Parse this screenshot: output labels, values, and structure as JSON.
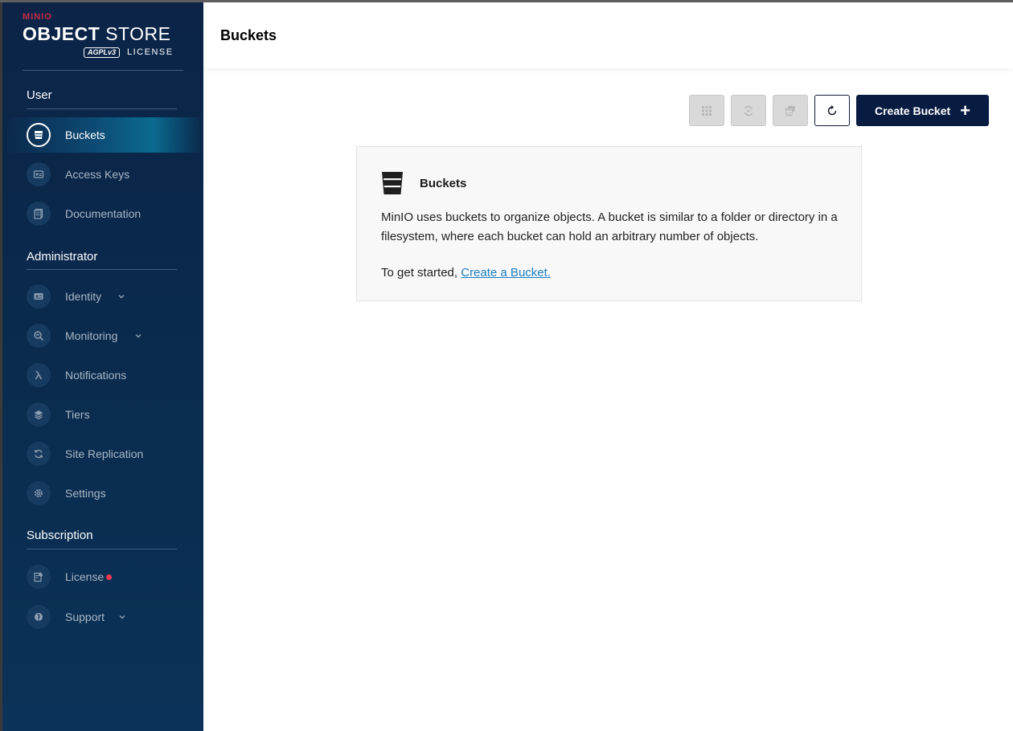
{
  "logo": {
    "brand": "MINIO",
    "product_bold": "OBJECT",
    "product_thin": "STORE",
    "badge": "AGPLv3",
    "license_word": "LICENSE"
  },
  "sidebar": {
    "sections": {
      "user": "User",
      "administrator": "Administrator",
      "subscription": "Subscription"
    },
    "items": {
      "buckets": "Buckets",
      "access_keys": "Access Keys",
      "documentation": "Documentation",
      "identity": "Identity",
      "monitoring": "Monitoring",
      "notifications": "Notifications",
      "tiers": "Tiers",
      "site_replication": "Site Replication",
      "settings": "Settings",
      "license": "License",
      "support": "Support"
    },
    "active_item": "buckets"
  },
  "header": {
    "title": "Buckets"
  },
  "toolbar": {
    "create_bucket_label": "Create Bucket",
    "create_bucket_icon": "plus-icon"
  },
  "info": {
    "title": "Buckets",
    "description": "MinIO uses buckets to organize objects. A bucket is similar to a folder or directory in a filesystem, where each bucket can hold an arbitrary number of objects.",
    "start_prefix": "To get started,",
    "start_link": "Create a Bucket."
  },
  "colors": {
    "sidebar_bg": "#0b2447",
    "primary_button": "#081c42",
    "link": "#1c7ec2",
    "license_dot": "#f0384e",
    "brand": "#c72c48"
  }
}
